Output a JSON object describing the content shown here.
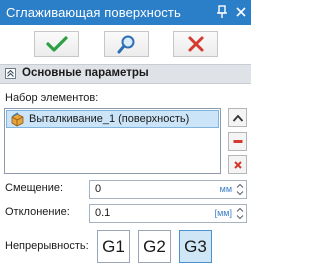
{
  "titlebar": {
    "title": "Сглаживающая поверхность",
    "pin_icon": "pin-icon",
    "close_icon": "close-icon"
  },
  "toolbar": {
    "ok_icon": "checkmark-icon",
    "preview_icon": "magnifier-icon",
    "cancel_icon": "cross-icon"
  },
  "section": {
    "label": "Основные параметры",
    "icon": "chevron-up-icon"
  },
  "elements": {
    "label": "Набор элементов:",
    "items": [
      {
        "label": "Выталкивание_1 (поверхность)",
        "icon": "extrusion-icon",
        "selected": true
      }
    ],
    "side_buttons": [
      "move-up-icon",
      "minus-icon",
      "delete-icon"
    ]
  },
  "offset": {
    "label": "Смещение:",
    "value": "0",
    "unit": "мм"
  },
  "deviation": {
    "label": "Отклонение:",
    "value": "0.1",
    "unit": "[мм]"
  },
  "continuity": {
    "label": "Непрерывность:",
    "options": [
      "G1",
      "G2",
      "G3"
    ],
    "selected": "G3"
  },
  "colors": {
    "title_bg": "#2b7fc8",
    "ok_green": "#2ea043",
    "cancel_red": "#d43a2f",
    "selected_bg": "#cce4f7"
  }
}
